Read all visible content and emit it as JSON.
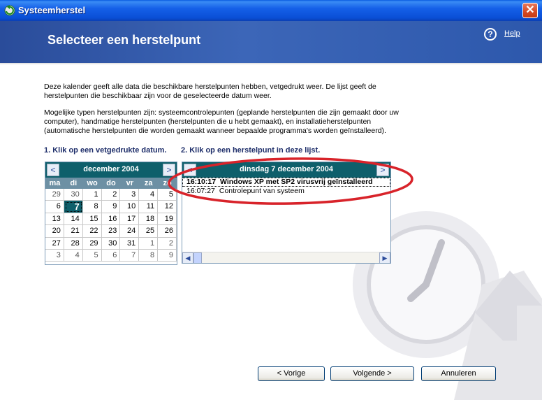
{
  "window": {
    "title": "Systeemherstel",
    "close_glyph": "✕"
  },
  "header": {
    "title": "Selecteer een herstelpunt",
    "help_icon_glyph": "?",
    "help_label": "Help"
  },
  "intro": {
    "paragraph1": "Deze kalender geeft alle data die beschikbare herstelpunten hebben, vetgedrukt weer. De lijst geeft de herstelpunten die beschikbaar zijn voor de geselecteerde datum weer.",
    "paragraph2": "Mogelijke typen herstelpunten zijn: systeemcontrolepunten (geplande herstelpunten die zijn gemaakt door uw computer), handmatige herstelpunten (herstelpunten die u hebt gemaakt), en installatieherstelpunten (automatische herstelpunten die worden gemaakt wanneer bepaalde programma's worden geïnstalleerd)."
  },
  "steps": {
    "step1": "1. Klik op een vetgedrukte datum.",
    "step2": "2. Klik op een herstelpunt in deze lijst."
  },
  "calendar": {
    "month_label": "december 2004",
    "prev_glyph": "<",
    "next_glyph": ">",
    "weekdays": [
      "ma",
      "di",
      "wo",
      "do",
      "vr",
      "za",
      "zo"
    ],
    "days": [
      {
        "d": "29",
        "other": true
      },
      {
        "d": "30",
        "other": true
      },
      {
        "d": "1"
      },
      {
        "d": "2"
      },
      {
        "d": "3"
      },
      {
        "d": "4"
      },
      {
        "d": "5"
      },
      {
        "d": "6"
      },
      {
        "d": "7",
        "selected": true
      },
      {
        "d": "8"
      },
      {
        "d": "9"
      },
      {
        "d": "10"
      },
      {
        "d": "11"
      },
      {
        "d": "12"
      },
      {
        "d": "13"
      },
      {
        "d": "14"
      },
      {
        "d": "15"
      },
      {
        "d": "16"
      },
      {
        "d": "17"
      },
      {
        "d": "18"
      },
      {
        "d": "19"
      },
      {
        "d": "20"
      },
      {
        "d": "21"
      },
      {
        "d": "22"
      },
      {
        "d": "23"
      },
      {
        "d": "24"
      },
      {
        "d": "25"
      },
      {
        "d": "26"
      },
      {
        "d": "27"
      },
      {
        "d": "28"
      },
      {
        "d": "29"
      },
      {
        "d": "30"
      },
      {
        "d": "31"
      },
      {
        "d": "1",
        "other": true
      },
      {
        "d": "2",
        "other": true
      },
      {
        "d": "3",
        "other": true
      },
      {
        "d": "4",
        "other": true
      },
      {
        "d": "5",
        "other": true
      },
      {
        "d": "6",
        "other": true
      },
      {
        "d": "7",
        "other": true
      },
      {
        "d": "8",
        "other": true
      },
      {
        "d": "9",
        "other": true
      }
    ]
  },
  "restore_list": {
    "date_label": "dinsdag 7 december 2004",
    "prev_glyph": "<",
    "next_glyph": ">",
    "items": [
      {
        "time": "16:10:17",
        "description": "Windows XP met SP2 virusvrij geïnstalleerd",
        "selected": true
      },
      {
        "time": "16:07:27",
        "description": "Controlepunt van systeem",
        "selected": false
      }
    ],
    "scroll_left_glyph": "◀",
    "scroll_right_glyph": "▶"
  },
  "buttons": {
    "back": "< Vorige",
    "next": "Volgende >",
    "cancel": "Annuleren"
  },
  "colors": {
    "banner": "#2d58ac",
    "calendar_header": "#0e5f6b",
    "annotation": "#d8232a",
    "step_text": "#1e2e6a"
  }
}
